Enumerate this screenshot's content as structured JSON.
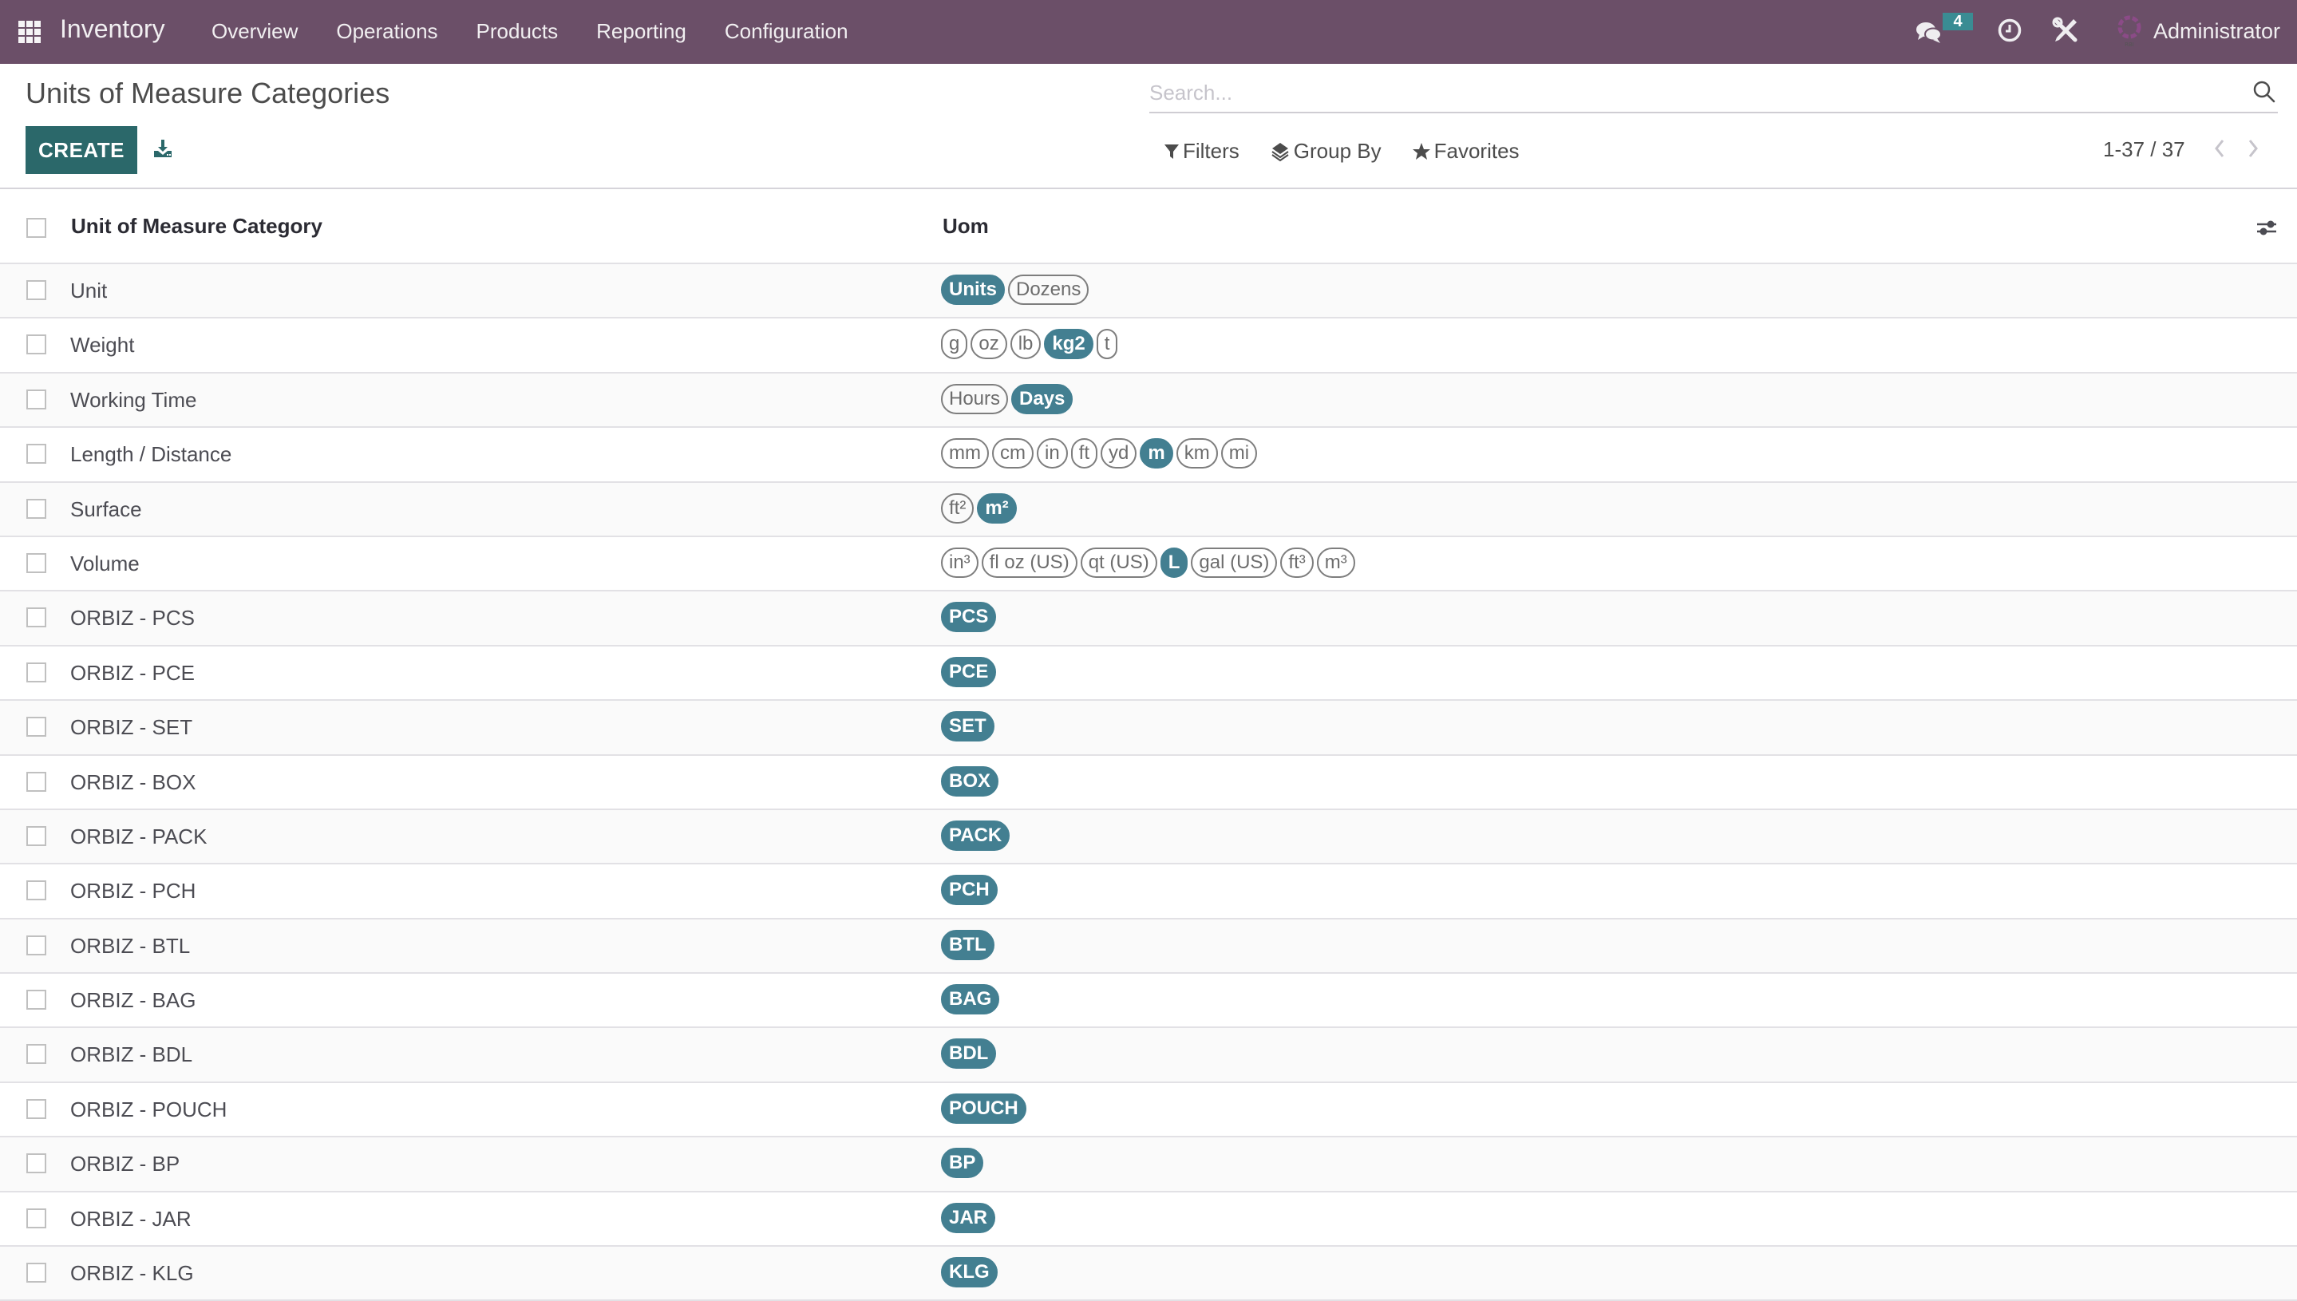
{
  "navbar": {
    "app_name": "Inventory",
    "menu": [
      {
        "label": "Overview"
      },
      {
        "label": "Operations"
      },
      {
        "label": "Products"
      },
      {
        "label": "Reporting"
      },
      {
        "label": "Configuration"
      }
    ],
    "messages_count": "4",
    "user_name": "Administrator",
    "colors": {
      "bar": "#6b4f68",
      "badge": "#3a8c93"
    }
  },
  "control_panel": {
    "title": "Units of Measure Categories",
    "create_label": "CREATE",
    "search_placeholder": "Search...",
    "filters_label": "Filters",
    "group_by_label": "Group By",
    "favorites_label": "Favorites",
    "pager": "1-37 / 37",
    "colors": {
      "primary": "#2b686a"
    }
  },
  "table": {
    "columns": [
      "Unit of Measure Category",
      "Uom"
    ],
    "tag_colors": {
      "filled": "#437f91",
      "outline": "#7e7e7e"
    },
    "rows": [
      {
        "name": "Unit",
        "uoms": [
          {
            "label": "Units",
            "reference": true
          },
          {
            "label": "Dozens",
            "reference": false
          }
        ]
      },
      {
        "name": "Weight",
        "uoms": [
          {
            "label": "g",
            "reference": false
          },
          {
            "label": "oz",
            "reference": false
          },
          {
            "label": "lb",
            "reference": false
          },
          {
            "label": "kg2",
            "reference": true
          },
          {
            "label": "t",
            "reference": false
          }
        ]
      },
      {
        "name": "Working Time",
        "uoms": [
          {
            "label": "Hours",
            "reference": false
          },
          {
            "label": "Days",
            "reference": true
          }
        ]
      },
      {
        "name": "Length / Distance",
        "uoms": [
          {
            "label": "mm",
            "reference": false
          },
          {
            "label": "cm",
            "reference": false
          },
          {
            "label": "in",
            "reference": false
          },
          {
            "label": "ft",
            "reference": false
          },
          {
            "label": "yd",
            "reference": false
          },
          {
            "label": "m",
            "reference": true
          },
          {
            "label": "km",
            "reference": false
          },
          {
            "label": "mi",
            "reference": false
          }
        ]
      },
      {
        "name": "Surface",
        "uoms": [
          {
            "label": "ft²",
            "reference": false
          },
          {
            "label": "m²",
            "reference": true
          }
        ]
      },
      {
        "name": "Volume",
        "uoms": [
          {
            "label": "in³",
            "reference": false
          },
          {
            "label": "fl oz (US)",
            "reference": false
          },
          {
            "label": "qt (US)",
            "reference": false
          },
          {
            "label": "L",
            "reference": true
          },
          {
            "label": "gal (US)",
            "reference": false
          },
          {
            "label": "ft³",
            "reference": false
          },
          {
            "label": "m³",
            "reference": false
          }
        ]
      },
      {
        "name": "ORBIZ - PCS",
        "uoms": [
          {
            "label": "PCS",
            "reference": true
          }
        ]
      },
      {
        "name": "ORBIZ - PCE",
        "uoms": [
          {
            "label": "PCE",
            "reference": true
          }
        ]
      },
      {
        "name": "ORBIZ - SET",
        "uoms": [
          {
            "label": "SET",
            "reference": true
          }
        ]
      },
      {
        "name": "ORBIZ - BOX",
        "uoms": [
          {
            "label": "BOX",
            "reference": true
          }
        ]
      },
      {
        "name": "ORBIZ - PACK",
        "uoms": [
          {
            "label": "PACK",
            "reference": true
          }
        ]
      },
      {
        "name": "ORBIZ - PCH",
        "uoms": [
          {
            "label": "PCH",
            "reference": true
          }
        ]
      },
      {
        "name": "ORBIZ - BTL",
        "uoms": [
          {
            "label": "BTL",
            "reference": true
          }
        ]
      },
      {
        "name": "ORBIZ - BAG",
        "uoms": [
          {
            "label": "BAG",
            "reference": true
          }
        ]
      },
      {
        "name": "ORBIZ - BDL",
        "uoms": [
          {
            "label": "BDL",
            "reference": true
          }
        ]
      },
      {
        "name": "ORBIZ - POUCH",
        "uoms": [
          {
            "label": "POUCH",
            "reference": true
          }
        ]
      },
      {
        "name": "ORBIZ - BP",
        "uoms": [
          {
            "label": "BP",
            "reference": true
          }
        ]
      },
      {
        "name": "ORBIZ - JAR",
        "uoms": [
          {
            "label": "JAR",
            "reference": true
          }
        ]
      },
      {
        "name": "ORBIZ - KLG",
        "uoms": [
          {
            "label": "KLG",
            "reference": true
          }
        ]
      }
    ]
  }
}
